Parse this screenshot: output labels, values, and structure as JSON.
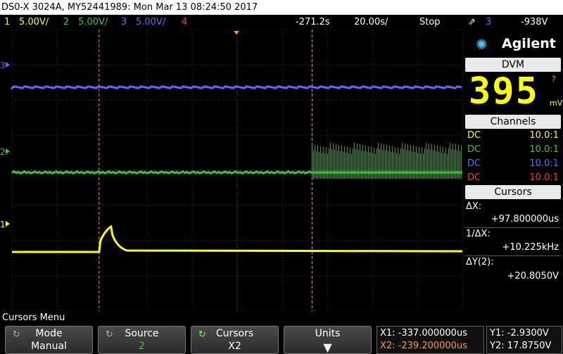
{
  "title": "DS0-X 3024A, MY52441989: Mon Mar 13 08:24:50 2017",
  "status": {
    "ch1_num": "1",
    "ch1_scale": "5.00V/",
    "ch2_num": "2",
    "ch2_scale": "5.00V/",
    "ch3_num": "3",
    "ch3_scale": "5.00V/",
    "ch4_num": "4",
    "delay": "-271.2s",
    "timebase": "20.00s/",
    "run_state": "Stop",
    "trig_source": "3",
    "trig_level": "-938V"
  },
  "screen": {
    "ch3_marker": "3",
    "ch2_marker": "2",
    "ch1_marker": "1"
  },
  "panel": {
    "brand": "Agilent",
    "dvm_header": "DVM",
    "dvm_value": "395",
    "dvm_unit": "mV",
    "dvm_flag": "?",
    "channels_header": "Channels",
    "channels": [
      {
        "coupling": "DC",
        "probe": "10.0:1"
      },
      {
        "coupling": "DC",
        "probe": "10.0:1"
      },
      {
        "coupling": "DC",
        "probe": "10.0:1"
      },
      {
        "coupling": "DC",
        "probe": "10.0:1"
      }
    ],
    "cursors_header": "Cursors",
    "dx_label": "ΔX:",
    "dx_value": "+97.800000us",
    "inv_dx_label": "1/ΔX:",
    "inv_dx_value": "+10.225kHz",
    "dy_label": "ΔY(2):",
    "dy_value": "+20.8050V"
  },
  "softkeys": {
    "menu_title": "Cursors Menu",
    "mode_label": "Mode",
    "mode_value": "Manual",
    "source_label": "Source",
    "source_value": "2",
    "cursors_label": "Cursors",
    "cursors_value": "X2",
    "units_label": "Units"
  },
  "readouts": {
    "x1": "X1: -337.000000us",
    "x2": "X2: -239.200000us",
    "y1": "Y1: -2.9300V",
    "y2": "Y2: 17.8750V"
  },
  "colors": {
    "ch1": "#ffff00",
    "ch2": "#33cc33",
    "ch3": "#6666ff",
    "ch4": "#ff3355",
    "cursor": "#ff9933"
  },
  "trace_shape": {
    "ch2_burst_start_fraction": 0.668,
    "ch1_pulse_fraction": 0.195
  }
}
